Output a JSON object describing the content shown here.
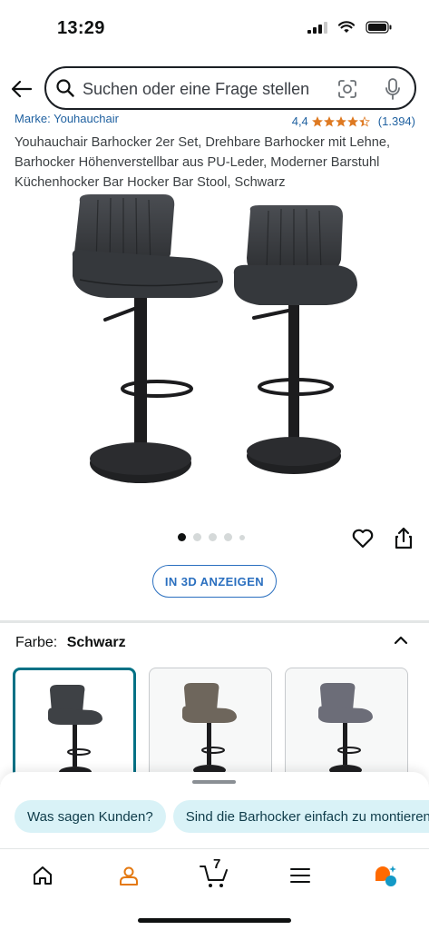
{
  "status_bar": {
    "time": "13:29",
    "icons": [
      "signal-icon",
      "wifi-icon",
      "battery-icon"
    ]
  },
  "search": {
    "placeholder": "Suchen oder eine Frage stellen",
    "icons": [
      "back-arrow-icon",
      "search-icon",
      "camera-lens-icon",
      "microphone-icon"
    ]
  },
  "product": {
    "brand_link": "Marke: Youhauchair",
    "rating_value": "4,4",
    "rating_stars": 4.4,
    "rating_count": "(1.394)",
    "title": "Youhauchair Barhocker 2er Set, Drehbare Barhocker mit Lehne, Barhocker Höhenverstellbar aus PU-Leder, Moderner Barstuhl Küchenhocker Bar Hocker Bar Stool, Schwarz",
    "image_count": 5,
    "active_image": 1,
    "view_3d_label": "IN 3D ANZEIGEN"
  },
  "color": {
    "label": "Farbe:",
    "value": "Schwarz",
    "swatches": [
      {
        "name": "Schwarz",
        "color": "#3e4145",
        "selected": true
      },
      {
        "name": "Braun",
        "color": "#6e665c",
        "selected": false
      },
      {
        "name": "Grau",
        "color": "#6c6d78",
        "selected": false
      }
    ]
  },
  "assistant": {
    "chips": [
      "Was sagen Kunden?",
      "Sind die Barhocker einfach zu montieren?"
    ]
  },
  "tab_bar": {
    "tabs": [
      {
        "name": "home-icon",
        "active": false
      },
      {
        "name": "account-icon",
        "active": true
      },
      {
        "name": "cart-icon",
        "badge": "7"
      },
      {
        "name": "menu-icon",
        "active": false
      },
      {
        "name": "rufus-assistant-icon",
        "active": false
      }
    ]
  },
  "colors": {
    "link": "#2162a1",
    "star": "#de7921",
    "selected_border": "#007185",
    "chip_bg": "#d9f2f7",
    "account_active": "#e47911"
  }
}
